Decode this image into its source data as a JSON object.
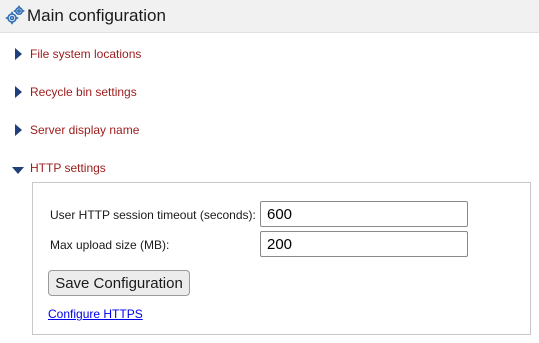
{
  "header": {
    "title": "Main configuration",
    "icon": "gears-icon"
  },
  "sections": [
    {
      "label": "File system locations",
      "expanded": false
    },
    {
      "label": "Recycle bin settings",
      "expanded": false
    },
    {
      "label": "Server display name",
      "expanded": false
    },
    {
      "label": "HTTP settings",
      "expanded": true
    }
  ],
  "http_settings": {
    "session_timeout_label": "User HTTP session timeout (seconds):",
    "session_timeout_value": "600",
    "max_upload_label": "Max upload size (MB):",
    "max_upload_value": "200",
    "save_button_label": "Save Configuration",
    "configure_https_link": "Configure HTTPS"
  },
  "colors": {
    "section_label": "#9b1b1b",
    "triangle": "#1f3f7a",
    "link": "#0000ee",
    "icon": "#2f6fb7"
  }
}
